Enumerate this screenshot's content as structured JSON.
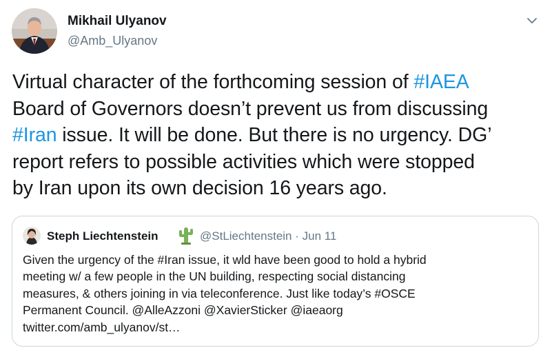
{
  "tweet": {
    "author": {
      "name": "Mikhail Ulyanov",
      "handle": "@Amb_Ulyanov"
    },
    "text_lines": [
      {
        "before": "Virtual character of the forthcoming session of ",
        "tag": "#IAEA",
        "after": ""
      },
      {
        "before": "Board of Governors doesn’t prevent us from discussing",
        "tag": "",
        "after": ""
      },
      {
        "before": "",
        "tag": "#Iran",
        "after": " issue. It will be done. But there is no urgency. DG’"
      },
      {
        "before": "report refers to possible activities which were stopped",
        "tag": "",
        "after": ""
      },
      {
        "before": "by Iran upon its own decision 16 years ago.",
        "tag": "",
        "after": ""
      }
    ]
  },
  "quoted": {
    "name": "Steph Liechtenstein",
    "meta": "@StLiechtenstein · Jun 11",
    "lines": [
      "Given the urgency of the #Iran issue, it wld have been good to hold a hybrid",
      "meeting w/ a few people in the UN building, respecting social distancing",
      "measures, & others joining in via teleconference. Just like today’s #OSCE",
      "Permanent Council. @AlleAzzoni @XavierSticker @iaeaorg",
      "twitter.com/amb_ulyanov/st…"
    ]
  },
  "icons": {
    "author_avatar": "profile-photo",
    "quoted_avatar": "profile-photo",
    "menu": "chevron-down-icon",
    "name_emoji": "cactus-emoji"
  },
  "colors": {
    "link": "#1b95e0",
    "secondary": "#657786",
    "border": "#ccd6dd"
  }
}
